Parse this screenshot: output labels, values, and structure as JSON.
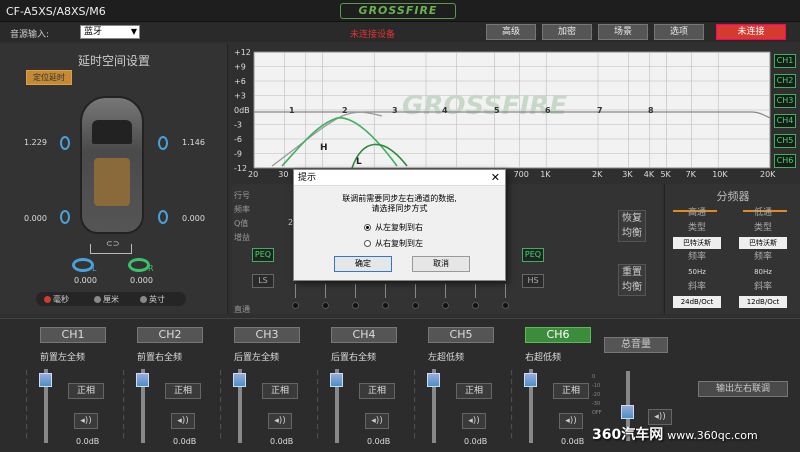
{
  "app": {
    "title": "CF-A5XS/A8XS/M6",
    "brand": "GROSSFIRE"
  },
  "toolbar": {
    "source_label": "音源输入:",
    "source_value": "蓝牙",
    "status": "未连接设备",
    "buttons": [
      "高级",
      "加密",
      "场景",
      "选项"
    ],
    "connect_label": "未连接"
  },
  "delay_panel": {
    "title": "延时空间设置",
    "orange_button": "定位延时",
    "front_left": "1.229",
    "front_right": "1.146",
    "rear_left": "0.000",
    "rear_right": "0.000",
    "sub_left": "0.000",
    "sub_right": "0.000",
    "units": [
      "毫秒",
      "厘米",
      "英寸"
    ],
    "sub_left_mark": "L",
    "sub_right_mark": "R",
    "link_mark": "⊂⊃"
  },
  "eq_graph": {
    "y_ticks": [
      "+12",
      "+9",
      "+6",
      "+3",
      "0dB",
      "-3",
      "-6",
      "-9",
      "-12"
    ],
    "x_ticks": [
      "20",
      "30",
      "40",
      "50",
      "100",
      "200",
      "300",
      "500",
      "700",
      "1K",
      "2K",
      "3K",
      "4K",
      "5K",
      "7K",
      "10K",
      "20K"
    ],
    "points": [
      "1",
      "2",
      "3",
      "4",
      "5",
      "6",
      "7",
      "8"
    ],
    "marker_h": "H",
    "marker_l": "L",
    "channels": [
      "CH1",
      "CH2",
      "CH3",
      "CH4",
      "CH5",
      "CH6"
    ]
  },
  "mid": {
    "row_labels": [
      "行号",
      "频率",
      "Q值",
      "增益"
    ],
    "q_partial": "2",
    "peq_left": "PEQ",
    "ls": "LS",
    "peq_right": "PEQ",
    "hs": "HS",
    "bottom_label": "直通",
    "restore": "恢复均衡",
    "reset": "重置均衡"
  },
  "dialog": {
    "title": "提示",
    "message_line1": "联调前需要同步左右通道的数据,",
    "message_line2": "请选择同步方式",
    "option1": "从左复制到右",
    "option2": "从右复制到左",
    "ok": "确定",
    "cancel": "取消"
  },
  "crossover": {
    "title": "分频器",
    "high": {
      "label": "高通",
      "type_label": "类型",
      "type": "巴特沃斯",
      "freq_label": "频率",
      "freq": "50Hz",
      "slope_label": "斜率",
      "slope": "24dB/Oct"
    },
    "low": {
      "label": "低通",
      "type_label": "类型",
      "type": "巴特沃斯",
      "freq_label": "频率",
      "freq": "80Hz",
      "slope_label": "斜率",
      "slope": "12dB/Oct"
    }
  },
  "channels": [
    {
      "name": "CH1",
      "desc": "前置左全频",
      "phase": "正相",
      "db": "0.0dB"
    },
    {
      "name": "CH2",
      "desc": "前置右全频",
      "phase": "正相",
      "db": "0.0dB"
    },
    {
      "name": "CH3",
      "desc": "后置左全频",
      "phase": "正相",
      "db": "0.0dB"
    },
    {
      "name": "CH4",
      "desc": "后置右全频",
      "phase": "正相",
      "db": "0.0dB"
    },
    {
      "name": "CH5",
      "desc": "左超低频",
      "phase": "正相",
      "db": "0.0dB"
    },
    {
      "name": "CH6",
      "desc": "右超低频",
      "phase": "正相",
      "db": "0.0dB"
    }
  ],
  "master": {
    "label": "总音量",
    "linked": "输出左右联调",
    "scale": [
      "0",
      "-10",
      "-20",
      "-30",
      "OFF"
    ]
  },
  "watermark": {
    "brand": "360汽车网",
    "url": "www.360qc.com"
  },
  "colors": {
    "accent_green": "#3cdc6a",
    "alert_red": "#d53a2f",
    "fader_blue": "#4a90c8",
    "crossover_orange": "#e08a20"
  }
}
